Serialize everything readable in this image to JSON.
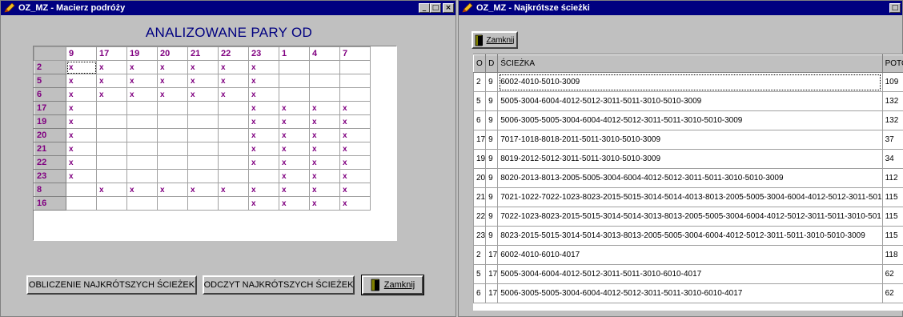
{
  "window1": {
    "title": "OZ_MZ - Macierz podróży",
    "heading": "ANALIZOWANE PARY OD",
    "columns": [
      "9",
      "17",
      "19",
      "20",
      "21",
      "22",
      "23",
      "1",
      "4",
      "7"
    ],
    "rows": [
      {
        "label": "2",
        "cells": [
          "x",
          "x",
          "x",
          "x",
          "x",
          "x",
          "x",
          "",
          "",
          ""
        ]
      },
      {
        "label": "5",
        "cells": [
          "x",
          "x",
          "x",
          "x",
          "x",
          "x",
          "x",
          "",
          "",
          ""
        ]
      },
      {
        "label": "6",
        "cells": [
          "x",
          "x",
          "x",
          "x",
          "x",
          "x",
          "x",
          "",
          "",
          ""
        ]
      },
      {
        "label": "17",
        "cells": [
          "x",
          "",
          "",
          "",
          "",
          "",
          "x",
          "x",
          "x",
          "x"
        ]
      },
      {
        "label": "19",
        "cells": [
          "x",
          "",
          "",
          "",
          "",
          "",
          "x",
          "x",
          "x",
          "x"
        ]
      },
      {
        "label": "20",
        "cells": [
          "x",
          "",
          "",
          "",
          "",
          "",
          "x",
          "x",
          "x",
          "x"
        ]
      },
      {
        "label": "21",
        "cells": [
          "x",
          "",
          "",
          "",
          "",
          "",
          "x",
          "x",
          "x",
          "x"
        ]
      },
      {
        "label": "22",
        "cells": [
          "x",
          "",
          "",
          "",
          "",
          "",
          "x",
          "x",
          "x",
          "x"
        ]
      },
      {
        "label": "23",
        "cells": [
          "x",
          "",
          "",
          "",
          "",
          "",
          "",
          "x",
          "x",
          "x"
        ]
      },
      {
        "label": "8",
        "cells": [
          "",
          "x",
          "x",
          "x",
          "x",
          "x",
          "x",
          "x",
          "x",
          "x"
        ]
      },
      {
        "label": "16",
        "cells": [
          "",
          "",
          "",
          "",
          "",
          "",
          "x",
          "x",
          "x",
          "x"
        ]
      }
    ],
    "buttons": {
      "compute": "OBLICZENIE NAJKRÓTSZYCH ŚCIEŻEK",
      "read": "ODCZYT NAJKRÓTSZYCH ŚCIEŻEK",
      "close": "Zamknij"
    },
    "title_buttons": [
      "_",
      "□",
      "×"
    ]
  },
  "window2": {
    "title": "OZ_MZ - Najkrótsze ścieżki",
    "close_button": "Zamknij",
    "headers": {
      "o": "O",
      "d": "D",
      "path": "ŚCIEŻKA",
      "flow": "POTOK"
    },
    "rows": [
      {
        "o": "2",
        "d": "9",
        "path": "6002-4010-5010-3009",
        "flow": "109"
      },
      {
        "o": "5",
        "d": "9",
        "path": "5005-3004-6004-4012-5012-3011-5011-3010-5010-3009",
        "flow": "132"
      },
      {
        "o": "6",
        "d": "9",
        "path": "5006-3005-5005-3004-6004-4012-5012-3011-5011-3010-5010-3009",
        "flow": "132"
      },
      {
        "o": "17",
        "d": "9",
        "path": "7017-1018-8018-2011-5011-3010-5010-3009",
        "flow": "37"
      },
      {
        "o": "19",
        "d": "9",
        "path": "8019-2012-5012-3011-5011-3010-5010-3009",
        "flow": "34"
      },
      {
        "o": "20",
        "d": "9",
        "path": "8020-2013-8013-2005-5005-3004-6004-4012-5012-3011-5011-3010-5010-3009",
        "flow": "112"
      },
      {
        "o": "21",
        "d": "9",
        "path": "7021-1022-7022-1023-8023-2015-5015-3014-5014-4013-8013-2005-5005-3004-6004-4012-5012-3011-501",
        "flow": "115"
      },
      {
        "o": "22",
        "d": "9",
        "path": "7022-1023-8023-2015-5015-3014-5014-3013-8013-2005-5005-3004-6004-4012-5012-3011-5011-3010-501",
        "flow": "115"
      },
      {
        "o": "23",
        "d": "9",
        "path": "8023-2015-5015-3014-5014-3013-8013-2005-5005-3004-6004-4012-5012-3011-5011-3010-5010-3009",
        "flow": "115"
      },
      {
        "o": "2",
        "d": "17",
        "path": "6002-4010-6010-4017",
        "flow": "118"
      },
      {
        "o": "5",
        "d": "17",
        "path": "5005-3004-6004-4012-5012-3011-5011-3010-6010-4017",
        "flow": "62"
      },
      {
        "o": "6",
        "d": "17",
        "path": "5006-3005-5005-3004-6004-4012-5012-3011-5011-3010-6010-4017",
        "flow": "62"
      }
    ]
  },
  "colors": {
    "titlebar": "#000080",
    "header_text": "#800080",
    "heading": "#000080"
  },
  "icons": [
    "pencil-app-icon",
    "door-exit-icon"
  ]
}
